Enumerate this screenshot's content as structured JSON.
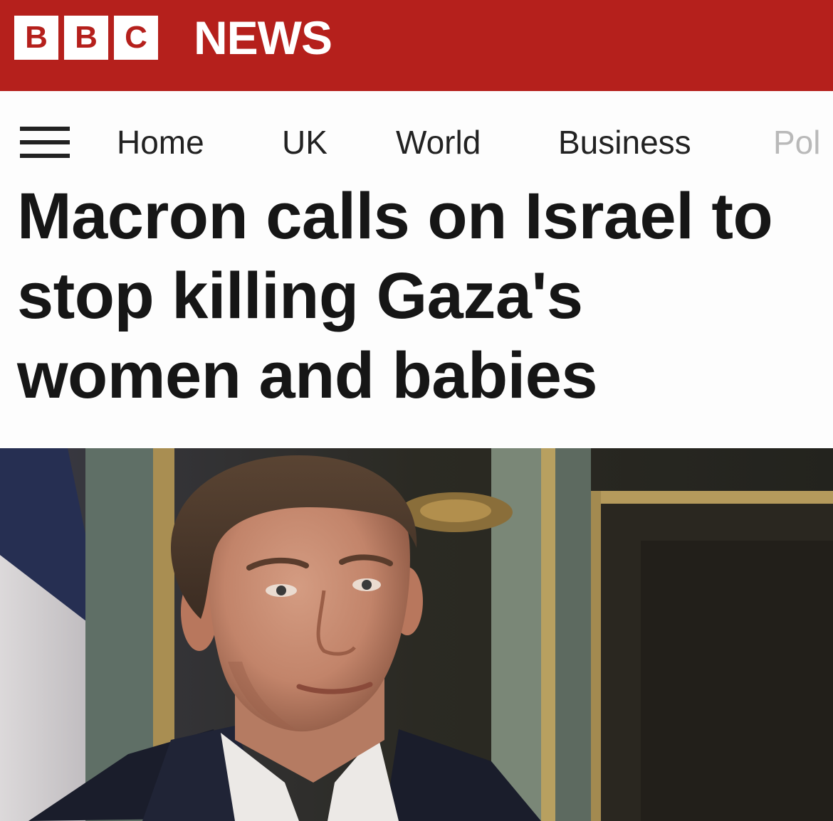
{
  "masthead": {
    "blocks": [
      "B",
      "B",
      "C"
    ],
    "news_label": "NEWS",
    "brand_color": "#b5201c"
  },
  "nav": {
    "menu_icon": "hamburger-menu-icon",
    "items": [
      {
        "label": "Home"
      },
      {
        "label": "UK"
      },
      {
        "label": "World"
      },
      {
        "label": "Business"
      },
      {
        "label": "Pol"
      }
    ]
  },
  "article": {
    "headline": "Macron calls on Israel to stop killing Gaza's women and babies"
  }
}
